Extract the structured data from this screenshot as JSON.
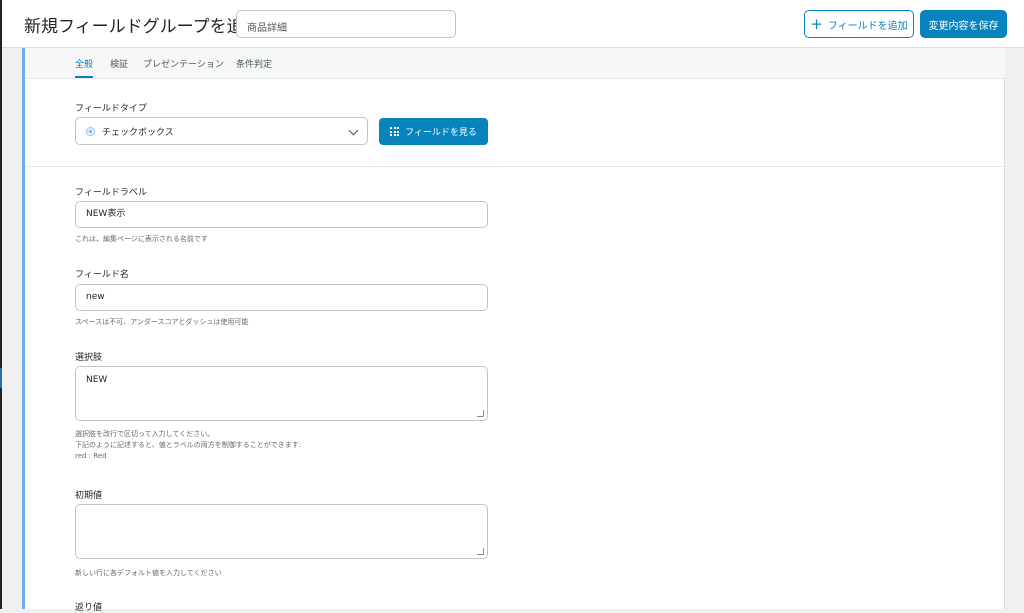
{
  "header": {
    "title": "新規フィールドグループを追加",
    "group_name_value": "商品詳細",
    "add_field_label": "フィールドを追加",
    "save_label": "変更内容を保存"
  },
  "tabs": [
    {
      "label": "全般",
      "active": true
    },
    {
      "label": "検証",
      "active": false
    },
    {
      "label": "プレゼンテーション",
      "active": false
    },
    {
      "label": "条件判定",
      "active": false
    }
  ],
  "field_type": {
    "label": "フィールドタイプ",
    "selected": "チェックボックス",
    "browse_label": "フィールドを見る"
  },
  "field_label": {
    "label": "フィールドラベル",
    "value": "NEW表示",
    "help": "これは、編集ページに表示される名前です"
  },
  "field_name": {
    "label": "フィールド名",
    "value": "new",
    "help": "スペースは不可、アンダースコアとダッシュは使用可能"
  },
  "choices": {
    "label": "選択肢",
    "value": "NEW",
    "help_line1": "選択肢を改行で区切って入力してください。",
    "help_line2": "下記のように記述すると、値とラベルの両方を制御することができます:",
    "help_line3": "red : Red"
  },
  "default_value": {
    "label": "初期値",
    "value": "",
    "help": "新しい行に各デフォルト値を入力してください"
  },
  "return_value": {
    "label": "返り値"
  },
  "colors": {
    "accent": "#0783be",
    "border": "#c3c4c7",
    "background": "#f0f0f1"
  }
}
